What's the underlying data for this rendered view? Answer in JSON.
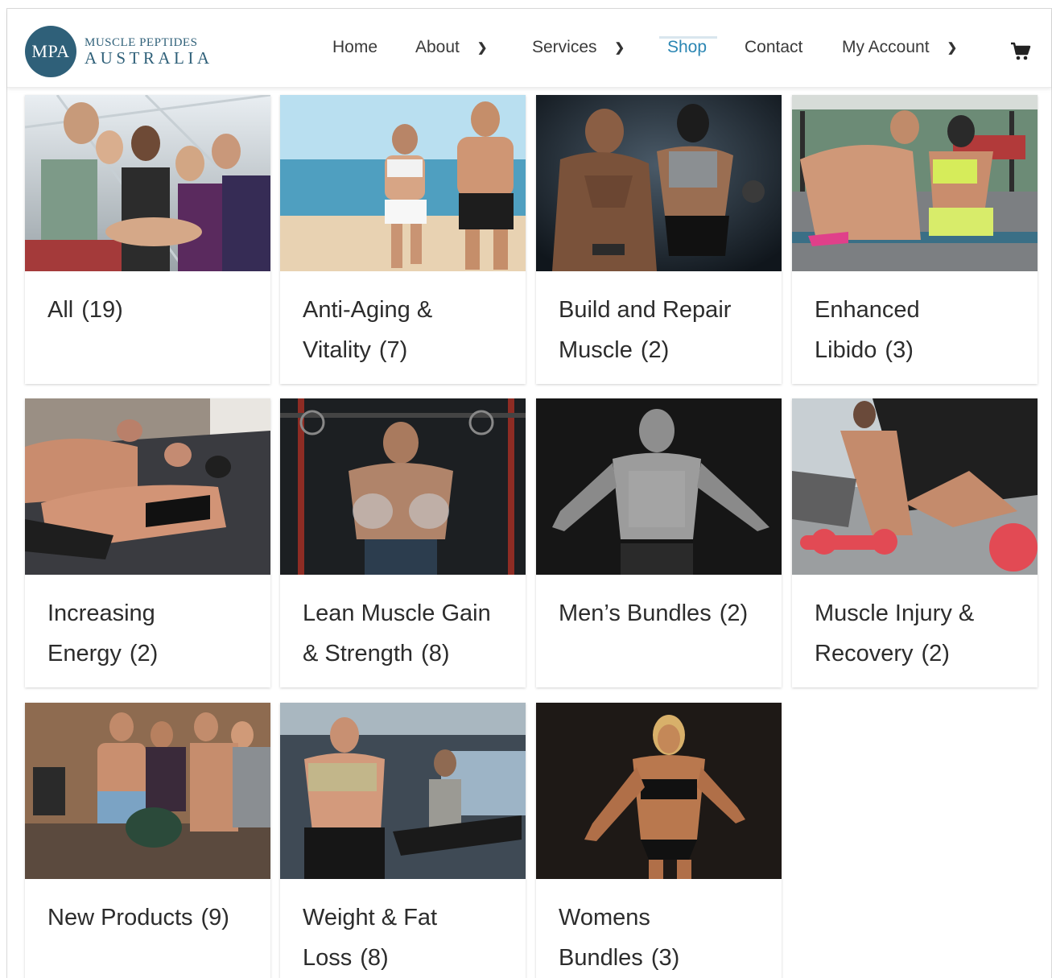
{
  "brand": {
    "logo_abbrev": "MPA",
    "line1": "MUSCLE PEPTIDES",
    "line2": "AUSTRALIA",
    "color": "#2f6079"
  },
  "nav": {
    "items": [
      {
        "label": "Home",
        "has_dropdown": false,
        "active": false
      },
      {
        "label": "About",
        "has_dropdown": true,
        "active": false
      },
      {
        "label": "Services",
        "has_dropdown": true,
        "active": false
      },
      {
        "label": "Shop",
        "has_dropdown": false,
        "active": true
      },
      {
        "label": "Contact",
        "has_dropdown": false,
        "active": false
      },
      {
        "label": "My Account",
        "has_dropdown": true,
        "active": false
      }
    ],
    "cart_icon": "shopping-cart-icon",
    "active_color": "#2b86b3"
  },
  "categories": [
    {
      "name": "All",
      "count": "(19)"
    },
    {
      "name": "Anti-Aging & Vitality",
      "count": "(7)"
    },
    {
      "name": "Build and Repair Muscle",
      "count": "(2)"
    },
    {
      "name": "Enhanced Libido",
      "count": "(3)"
    },
    {
      "name": "Increasing Energy",
      "count": "(2)"
    },
    {
      "name": "Lean Muscle Gain & Strength",
      "count": "(8)"
    },
    {
      "name": "Men’s Bundles",
      "count": "(2)"
    },
    {
      "name": "Muscle Injury & Recovery",
      "count": "(2)"
    },
    {
      "name": "New Products",
      "count": "(9)"
    },
    {
      "name": "Weight & Fat Loss",
      "count": "(8)"
    },
    {
      "name": "Womens Bundles",
      "count": "(3)"
    }
  ]
}
